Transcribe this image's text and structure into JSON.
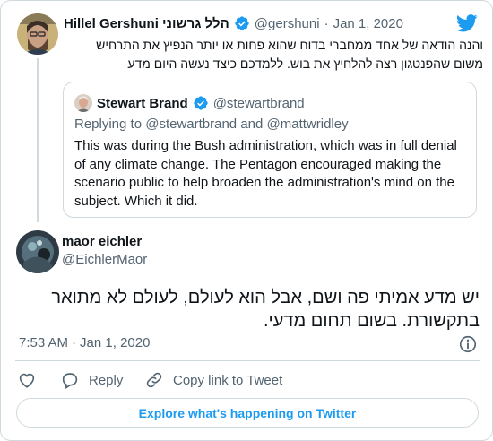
{
  "colors": {
    "accent": "#1d9bf0",
    "text": "#0f1419",
    "muted": "#536471",
    "border": "#cfd9de"
  },
  "tweet": {
    "author_name": "Hillel Gershuni הלל גרשוני",
    "handle": "@gershuni",
    "separator": "·",
    "date": "Jan 1, 2020",
    "text_lines": [
      "והנה הודאה של אחד ממחברי בדוח שהוא פחות או יותר הנפיץ את התרחיש",
      "משום שהפנטגון רצה להלחיץ את בוש. ללמדכם כיצד נעשה היום מדע"
    ]
  },
  "quoted_tweet": {
    "author_name": "Stewart Brand",
    "handle": "@stewartbrand",
    "replying_to": "Replying to @stewartbrand and @mattwridley",
    "text_lines": [
      "This was during the Bush administration, which was in full denial",
      "of any climate change.  The Pentagon encouraged making the",
      "scenario public to help broaden the administration's mind on the",
      "subject.  Which it did."
    ]
  },
  "reply": {
    "author_name": "maor eichler",
    "handle": "@EichlerMaor",
    "text_lines": [
      "יש מדע אמיתי פה ושם, אבל הוא לעולם, לעולם לא מתואר",
      "בתקשורת. בשום תחום מדעי."
    ],
    "time": "7:53 AM",
    "separator": "·",
    "date": "Jan 1, 2020"
  },
  "actions": {
    "reply_label": "Reply",
    "copy_link_label": "Copy link to Tweet"
  },
  "explore_label": "Explore what's happening on Twitter",
  "icons": {
    "brand": "twitter-bird-icon",
    "verified": "verified-badge-icon",
    "like": "heart-icon",
    "reply": "reply-bubble-icon",
    "link": "link-icon",
    "info": "info-icon"
  }
}
